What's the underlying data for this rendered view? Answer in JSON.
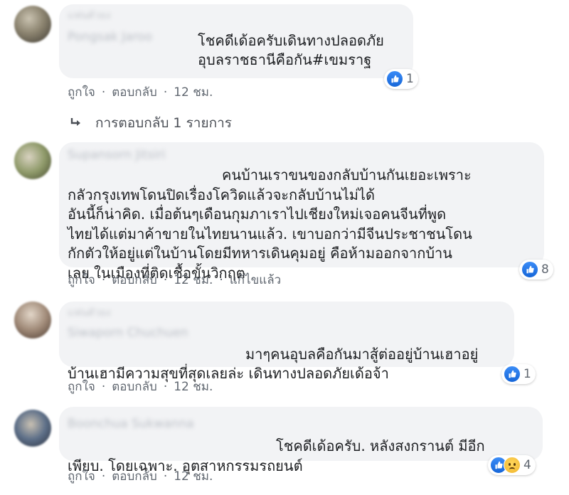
{
  "comments": [
    {
      "badge": "แฟนตัวยง",
      "author": "Pongsak Jaroo",
      "text": "โชคดีเด้อครับเดินทางปลอดภัย\nอุบลราชธานีคือกัน#เขมราฐ",
      "actions": {
        "like": "ถูกใจ",
        "reply": "ตอบกลับ",
        "time": "12 ชม.",
        "edited": ""
      },
      "reaction_count": "1"
    },
    {
      "badge": "",
      "author": "Supansorn Jitsiri",
      "text": "คนบ้านเราขนของกลับบ้านกันเยอะเพราะ\nกลัวกรุงเทพโดนปิดเรื่องโควิดแล้วจะกลับบ้านไม่ได้\nอันนี้ก็น่าคิด. เมื่อต้นๆเดือนกุมภาเราไปเชียงใหม่เจอคนจีนที่พูด\nไทยได้แต่มาค้าขายในไทยนานแล้ว. เขาบอกว่ามีจีนประชาชนโดน\nกักตัวให้อยู่แต่ในบ้านโดยมีทหารเดินคุมอยู่ คือห้ามออกจากบ้าน\nเลย ในเมืองที่ติดเชื้อขั้นวิกฤต",
      "actions": {
        "like": "ถูกใจ",
        "reply": "ตอบกลับ",
        "time": "12 ชม.",
        "edited": "แก้ไขแล้ว"
      },
      "reaction_count": "8"
    },
    {
      "badge": "แฟนตัวยง",
      "author": "Siwaporn Chuchuen",
      "text": "มาๆคนอุบลคือกันมาสู้ต่ออยู่บ้านเฮาอยู่\nบ้านเฮามีความสุขที่สุดเลยล่ะ เดินทางปลอดภัยเด้อจ้า",
      "actions": {
        "like": "ถูกใจ",
        "reply": "ตอบกลับ",
        "time": "12 ชม.",
        "edited": ""
      },
      "reaction_count": "1"
    },
    {
      "badge": "",
      "author": "Boonchua Sukwanna",
      "text": "โชคดีเด้อครับ. หลังสงกรานต์ มีอีก\nเพียบ. โดยเฉพาะ. อุตสาหกรรมรถยนต์",
      "actions": {
        "like": "ถูกใจ",
        "reply": "ตอบกลับ",
        "time": "12 ชม.",
        "edited": ""
      },
      "reaction_count": "4"
    }
  ],
  "reply_link": "การตอบกลับ 1 รายการ",
  "icons": {
    "like": "like-icon",
    "sad": "sad-icon",
    "reply_arrow": "reply-arrow-icon"
  },
  "colors": {
    "bubble": "#f2f3f5",
    "like_blue": "#1877f2",
    "meta_text": "#606770"
  }
}
